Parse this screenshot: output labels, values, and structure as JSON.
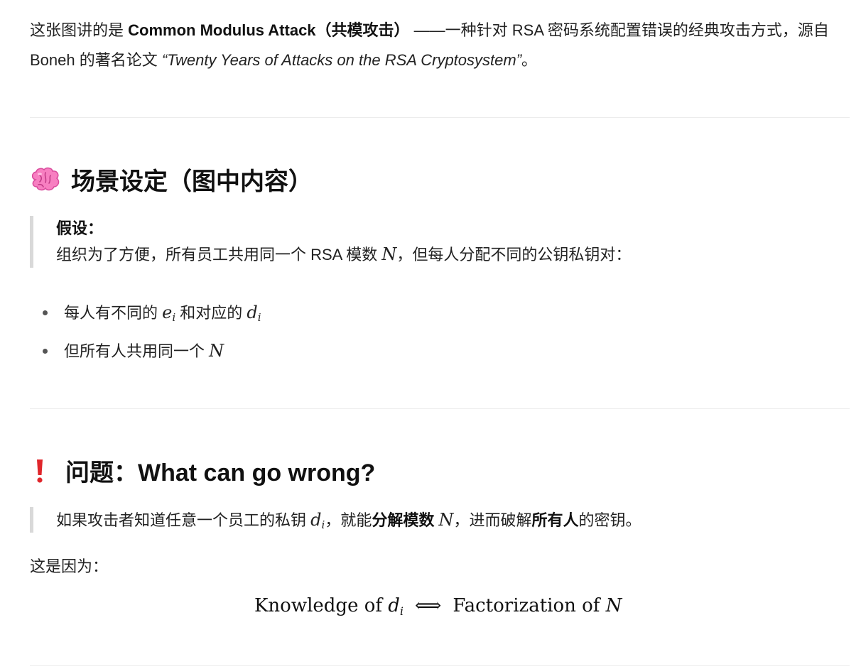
{
  "intro": {
    "part1": "这张图讲的是 ",
    "title_bold": "Common Modulus Attack（共模攻击）",
    "part2": " ——一种针对 RSA 密码系统配置错误的经典攻击方式，源自 Boneh 的著名论文 ",
    "paper_title": "“Twenty Years of Attacks on the RSA Cryptosystem”",
    "part3": "。"
  },
  "section1": {
    "icon": "brain-emoji-icon",
    "heading": "场景设定（图中内容）",
    "quote_label": "假设：",
    "quote_text_before": "组织为了方便，所有员工共用同一个 RSA 模数 ",
    "quote_math_N": "N",
    "quote_text_after": "，但每人分配不同的公钥私钥对：",
    "bullets": [
      {
        "text": "每人有不同的 ",
        "math1": "e",
        "sub1": "i",
        "mid": " 和对应的 ",
        "math2": "d",
        "sub2": "i"
      },
      {
        "text": "但所有人共用同一个 ",
        "math1": "N"
      }
    ]
  },
  "section2": {
    "icon": "exclamation-emoji-icon",
    "icon_color": "#e0262b",
    "heading": "问题：What can go wrong?",
    "quote_part1": "如果攻击者知道任意一个员工的私钥 ",
    "quote_math_d": "d",
    "quote_math_sub": "i",
    "quote_part2": "，就能",
    "quote_bold1": "分解模数",
    "quote_math_N": "N",
    "quote_part3": "，进而破解",
    "quote_bold2": "所有人",
    "quote_part4": "的密钥。",
    "para": "这是因为：",
    "formula": {
      "left": "Knowledge of ",
      "left_var": "d",
      "left_sub": "i",
      "arrow": "⟺",
      "right": "Factorization of ",
      "right_var": "N"
    }
  }
}
